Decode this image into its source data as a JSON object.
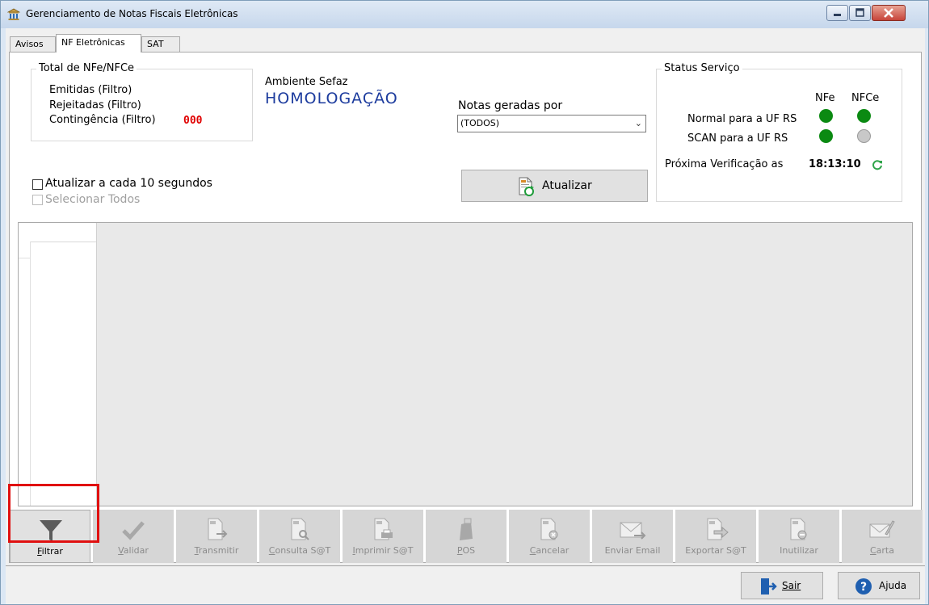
{
  "window": {
    "title": "Gerenciamento de Notas Fiscais Eletrônicas",
    "icon": "bank-building-icon"
  },
  "tabs": [
    {
      "label": "Avisos",
      "active": false
    },
    {
      "label": "NF Eletrônicas",
      "active": true
    },
    {
      "label": "SAT",
      "active": false
    }
  ],
  "totals": {
    "legend": "Total de NFe/NFCe",
    "emitidas": "Emitidas (Filtro)",
    "rejeitadas": "Rejeitadas (Filtro)",
    "contingencia": "Contingência (Filtro)",
    "contingencia_value": "000"
  },
  "ambiente": {
    "label": "Ambiente Sefaz",
    "value": "HOMOLOGAÇÃO"
  },
  "notas": {
    "label": "Notas geradas por",
    "selected": "(TODOS)"
  },
  "options": {
    "auto_update": "Atualizar a cada 10 segundos",
    "select_all": "Selecionar Todos"
  },
  "atualizar_button": "Atualizar",
  "status": {
    "legend": "Status Serviço",
    "col_nfe": "NFe",
    "col_nfce": "NFCe",
    "row_normal": "Normal para a UF RS",
    "row_scan": "SCAN para a UF RS",
    "next_check_label": "Próxima Verificação as",
    "next_check_time": "18:13:10",
    "colors": {
      "green": "#0b8a12",
      "gray": "#c8c8c8"
    }
  },
  "toolbar": [
    {
      "label": "Filtrar",
      "accel": "F",
      "rest": "iltrar",
      "enabled": true,
      "icon": "funnel-icon"
    },
    {
      "label": "Validar",
      "accel": "V",
      "rest": "alidar",
      "enabled": false,
      "icon": "checkmark-icon"
    },
    {
      "label": "Transmitir",
      "accel": "T",
      "rest": "ransmitir",
      "enabled": false,
      "icon": "document-send-icon"
    },
    {
      "label": "Consulta S@T",
      "accel": "C",
      "rest": "onsulta S@T",
      "enabled": false,
      "icon": "document-search-icon"
    },
    {
      "label": "Imprimir S@T",
      "accel": "I",
      "rest": "mprimir S@T",
      "enabled": false,
      "icon": "document-print-icon"
    },
    {
      "label": "POS",
      "accel": "P",
      "rest": "OS",
      "enabled": false,
      "icon": "pos-terminal-icon"
    },
    {
      "label": "Cancelar",
      "accel": "C",
      "rest": "ancelar",
      "enabled": false,
      "icon": "document-cancel-icon"
    },
    {
      "label": "Enviar Email",
      "accel": "",
      "rest": "Enviar Email",
      "enabled": false,
      "icon": "email-send-icon"
    },
    {
      "label": "Exportar S@T",
      "accel": "",
      "rest": "Exportar S@T",
      "enabled": false,
      "icon": "document-export-icon"
    },
    {
      "label": "Inutilizar",
      "accel": "",
      "rest": "Inutilizar",
      "enabled": false,
      "icon": "document-disable-icon"
    },
    {
      "label": "Carta",
      "accel": "C",
      "rest": "arta",
      "enabled": false,
      "icon": "letter-icon"
    }
  ],
  "bottom": {
    "sair": "Sair",
    "ajuda": "Ajuda"
  }
}
